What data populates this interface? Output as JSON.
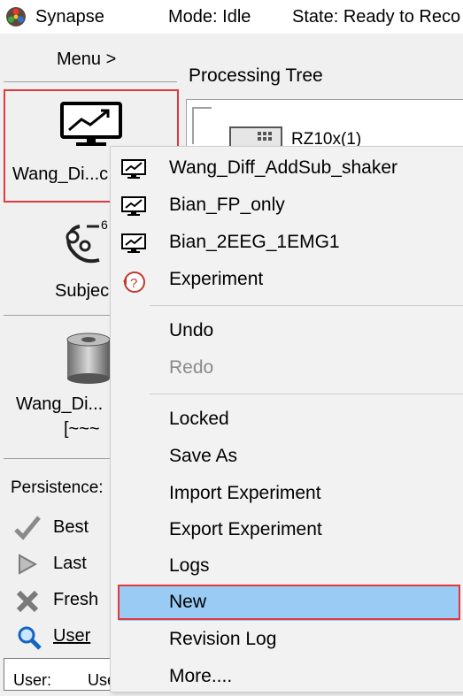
{
  "window": {
    "title": "Synapse",
    "mode": "Mode: Idle",
    "state": "State: Ready to Reco"
  },
  "sidebar": {
    "menu_label": "Menu >",
    "experiment_label": "Wang_Di...c",
    "subject_label": "Subjec",
    "subject_badge": "6",
    "tank_label": "Wang_Di...",
    "tank_sublabel": "[~~~",
    "persistence_label": "Persistence:",
    "persistence_options": [
      "Best",
      "Last",
      "Fresh",
      "User"
    ],
    "user_field_label": "User:",
    "user_field_value": "Use"
  },
  "tree": {
    "title": "Processing Tree",
    "device_label": "RZ10x(1)"
  },
  "context_menu": {
    "items": [
      {
        "label": "Wang_Diff_AddSub_shaker",
        "icon": "monitor-chart-icon"
      },
      {
        "label": "Bian_FP_only",
        "icon": "monitor-chart-icon"
      },
      {
        "label": "Bian_2EEG_1EMG1",
        "icon": "monitor-chart-icon"
      },
      {
        "label": "Experiment",
        "icon": "experiment-help-icon"
      },
      {
        "label": "Undo"
      },
      {
        "label": "Redo",
        "state": "disabled"
      },
      {
        "label": "Locked"
      },
      {
        "label": "Save As"
      },
      {
        "label": "Import Experiment"
      },
      {
        "label": "Export Experiment"
      },
      {
        "label": "Logs"
      },
      {
        "label": "New",
        "state": "highlighted"
      },
      {
        "label": "Revision Log"
      },
      {
        "label": "More...."
      }
    ]
  },
  "colors": {
    "highlight": "#99cbf5",
    "annotation_outline": "#e0393e"
  }
}
